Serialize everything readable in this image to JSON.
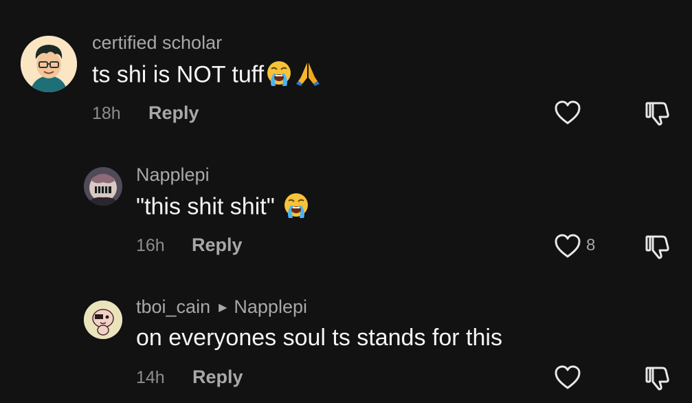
{
  "comments": [
    {
      "username": "certified scholar",
      "text": "ts shi is NOT tuff",
      "emojis": [
        "loudly-crying-face",
        "folded-hands"
      ],
      "time": "18h",
      "reply_label": "Reply",
      "like_count": ""
    },
    {
      "username": "Napplepi",
      "text": "\"this shit shit\"",
      "emojis": [
        "loudly-crying-face"
      ],
      "time": "16h",
      "reply_label": "Reply",
      "like_count": "8"
    },
    {
      "username": "tboi_cain",
      "reply_to": "Napplepi",
      "text": "on everyones soul ts stands for this",
      "time": "14h",
      "reply_label": "Reply",
      "like_count": ""
    }
  ],
  "colors": {
    "background": "#121212",
    "muted_text": "#a8a8a8",
    "body_text": "#f5f5f5"
  }
}
